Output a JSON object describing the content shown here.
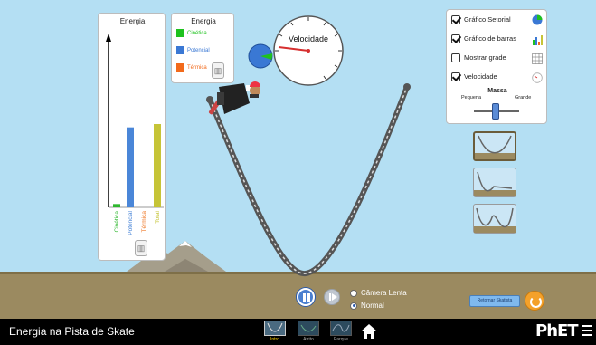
{
  "bar_chart": {
    "title": "Energia",
    "bars": [
      {
        "label": "Cinética",
        "value": 2,
        "color": "#2eb82e"
      },
      {
        "label": "Potencial",
        "value": 48,
        "color": "#4a86d8"
      },
      {
        "label": "Térmica",
        "value": 0,
        "color": "#f07d2e"
      },
      {
        "label": "Total",
        "value": 50,
        "color": "#c6c437"
      }
    ],
    "axis_max": 100
  },
  "pie_legend": {
    "title": "Energia",
    "items": [
      {
        "label": "Cinética",
        "color": "#1ec21e"
      },
      {
        "label": "Potencial",
        "color": "#3a78d4"
      },
      {
        "label": "Térmica",
        "color": "#f26a1b"
      }
    ]
  },
  "speedometer": {
    "title": "Velocidade",
    "needle_fraction": 0.05
  },
  "controls": {
    "pie_chart": {
      "label": "Gráfico Setorial",
      "checked": true
    },
    "bar_chart": {
      "label": "Gráfico de barras",
      "checked": true
    },
    "grid": {
      "label": "Mostrar grade",
      "checked": false
    },
    "speed": {
      "label": "Velocidade",
      "checked": true
    },
    "mass": {
      "title": "Massa",
      "min_label": "Pequena",
      "max_label": "Grande",
      "level": 0.5
    }
  },
  "playback": {
    "slow_label": "Câmera Lenta",
    "normal_label": "Normal",
    "selected": "normal"
  },
  "return_skater_label": "Retornar Skatista",
  "navbar": {
    "sim_title": "Energia na Pista de Skate",
    "screens": [
      {
        "label": "Intro",
        "selected": true
      },
      {
        "label": "Atrito",
        "selected": false
      },
      {
        "label": "Parque",
        "selected": false
      }
    ],
    "logo": "PhET"
  },
  "colors": {
    "kinetic": "#2eb82e",
    "potential": "#4a86d8",
    "thermal": "#f07d2e",
    "total": "#c6c437",
    "sky": "#b4dff3",
    "ground": "#9b8a60"
  }
}
